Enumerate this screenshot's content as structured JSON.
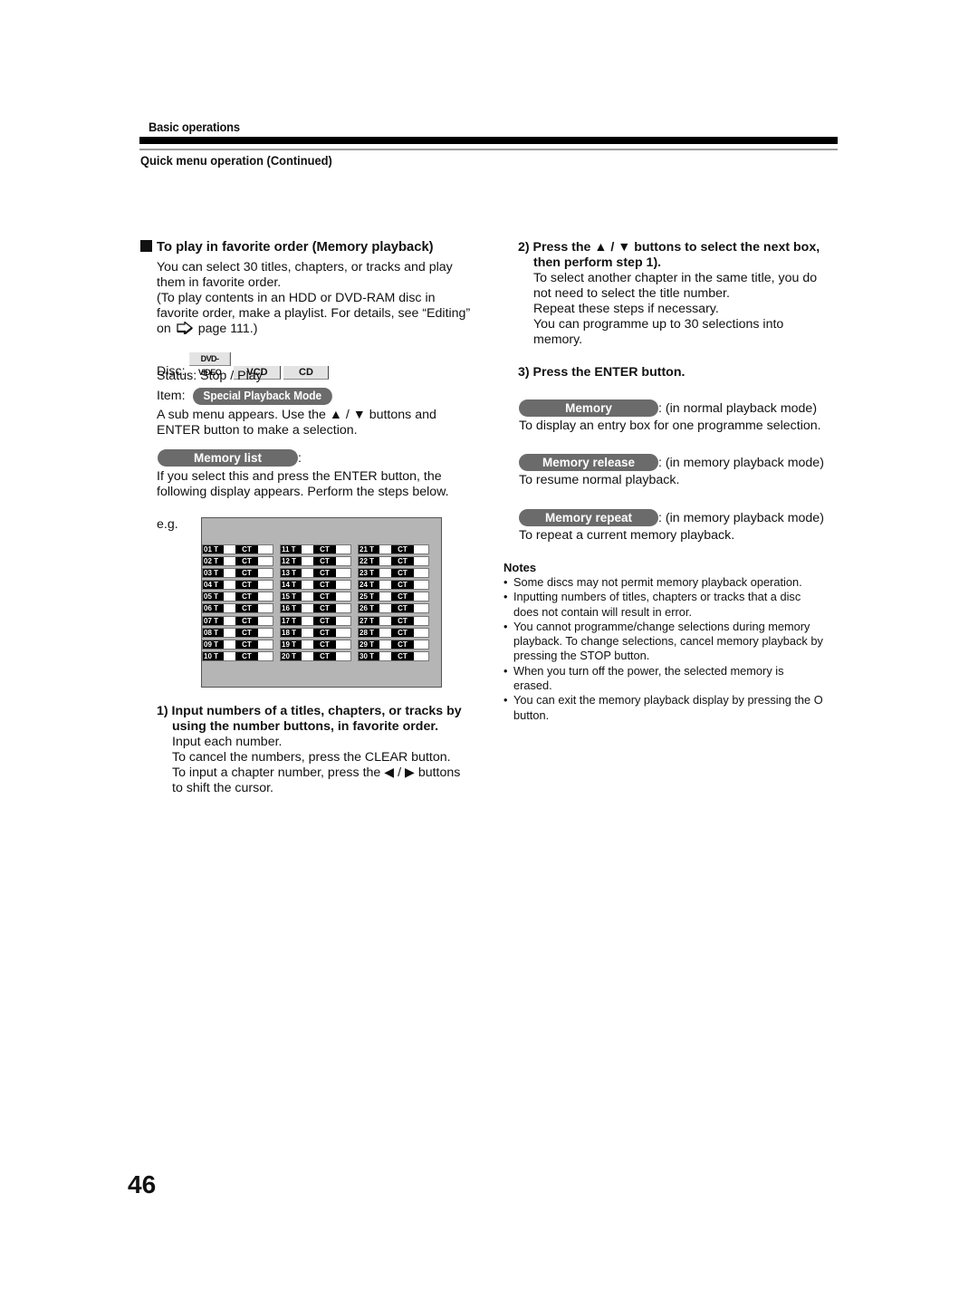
{
  "header": {
    "section": "Basic operations",
    "subsection": "Quick menu operation (Continued)"
  },
  "left": {
    "heading": "To play in favorite order (Memory playback)",
    "intro_lines": [
      "You can select 30 titles, chapters, or tracks and play",
      "them in favorite order.",
      "(To play contents in an HDD or DVD-RAM disc in",
      "favorite order, make a playlist. For details, see “Editing”"
    ],
    "ref_prefix": "on",
    "ref_page": "page 111.)",
    "disc_label": "Disc:",
    "discs": [
      "DVD-VIDEO",
      "VCD",
      "CD"
    ],
    "status_line": "Status: Stop / Play",
    "item_label": "Item:",
    "item_value": "Special Playback Mode",
    "submenu_lines": [
      "A sub menu appears. Use the ▲ / ▼ buttons and",
      "ENTER button to make a selection."
    ],
    "memory_list_label": "Memory list",
    "memory_list_colon": ":",
    "memory_list_desc": [
      "If you select this and press the ENTER button, the",
      "following display appears. Perform the steps below."
    ],
    "eg_label": "e.g.",
    "osd": {
      "title_suffix": "T",
      "chapter_label": "CT",
      "columns": [
        [
          "01",
          "02",
          "03",
          "04",
          "05",
          "06",
          "07",
          "08",
          "09",
          "10"
        ],
        [
          "11",
          "12",
          "13",
          "14",
          "15",
          "16",
          "17",
          "18",
          "19",
          "20"
        ],
        [
          "21",
          "22",
          "23",
          "24",
          "25",
          "26",
          "27",
          "28",
          "29",
          "30"
        ]
      ]
    },
    "step1": {
      "title_lines": [
        "1) Input numbers of a titles, chapters, or tracks by",
        "using the number buttons, in favorite order."
      ],
      "body_lines": [
        "Input each number.",
        "To cancel the numbers, press the CLEAR button.",
        "To input a chapter number, press the ◀ / ▶ buttons",
        "to shift the cursor."
      ]
    }
  },
  "right": {
    "step2": {
      "title_lines": [
        "2) Press the ▲ / ▼ buttons to select the next box,",
        "then perform step 1)."
      ],
      "body_lines": [
        "To select another chapter in the same title, you do",
        "not need to select the title number.",
        "Repeat these steps if necessary.",
        "You can programme up to 30 selections into",
        "memory."
      ]
    },
    "step3": {
      "title": "3) Press the ENTER button."
    },
    "options": [
      {
        "label": "Memory",
        "mode": ": (in normal playback mode)",
        "desc": "To display an entry box for one programme selection."
      },
      {
        "label": "Memory release",
        "mode": ": (in memory playback mode)",
        "desc": "To resume normal playback."
      },
      {
        "label": "Memory repeat",
        "mode": ": (in memory playback mode)",
        "desc": "To repeat a current memory playback."
      }
    ],
    "notes": {
      "title": "Notes",
      "items": [
        "Some discs may not permit memory playback operation.",
        "Inputting numbers of titles, chapters or tracks that a disc does not contain will result in error.",
        "You cannot programme/change selections during memory playback. To change selections, cancel memory playback by pressing the STOP button.",
        "When you turn off the power, the selected memory is erased.",
        "You can exit the memory playback display by pressing the O button."
      ]
    }
  },
  "page_number": "46"
}
